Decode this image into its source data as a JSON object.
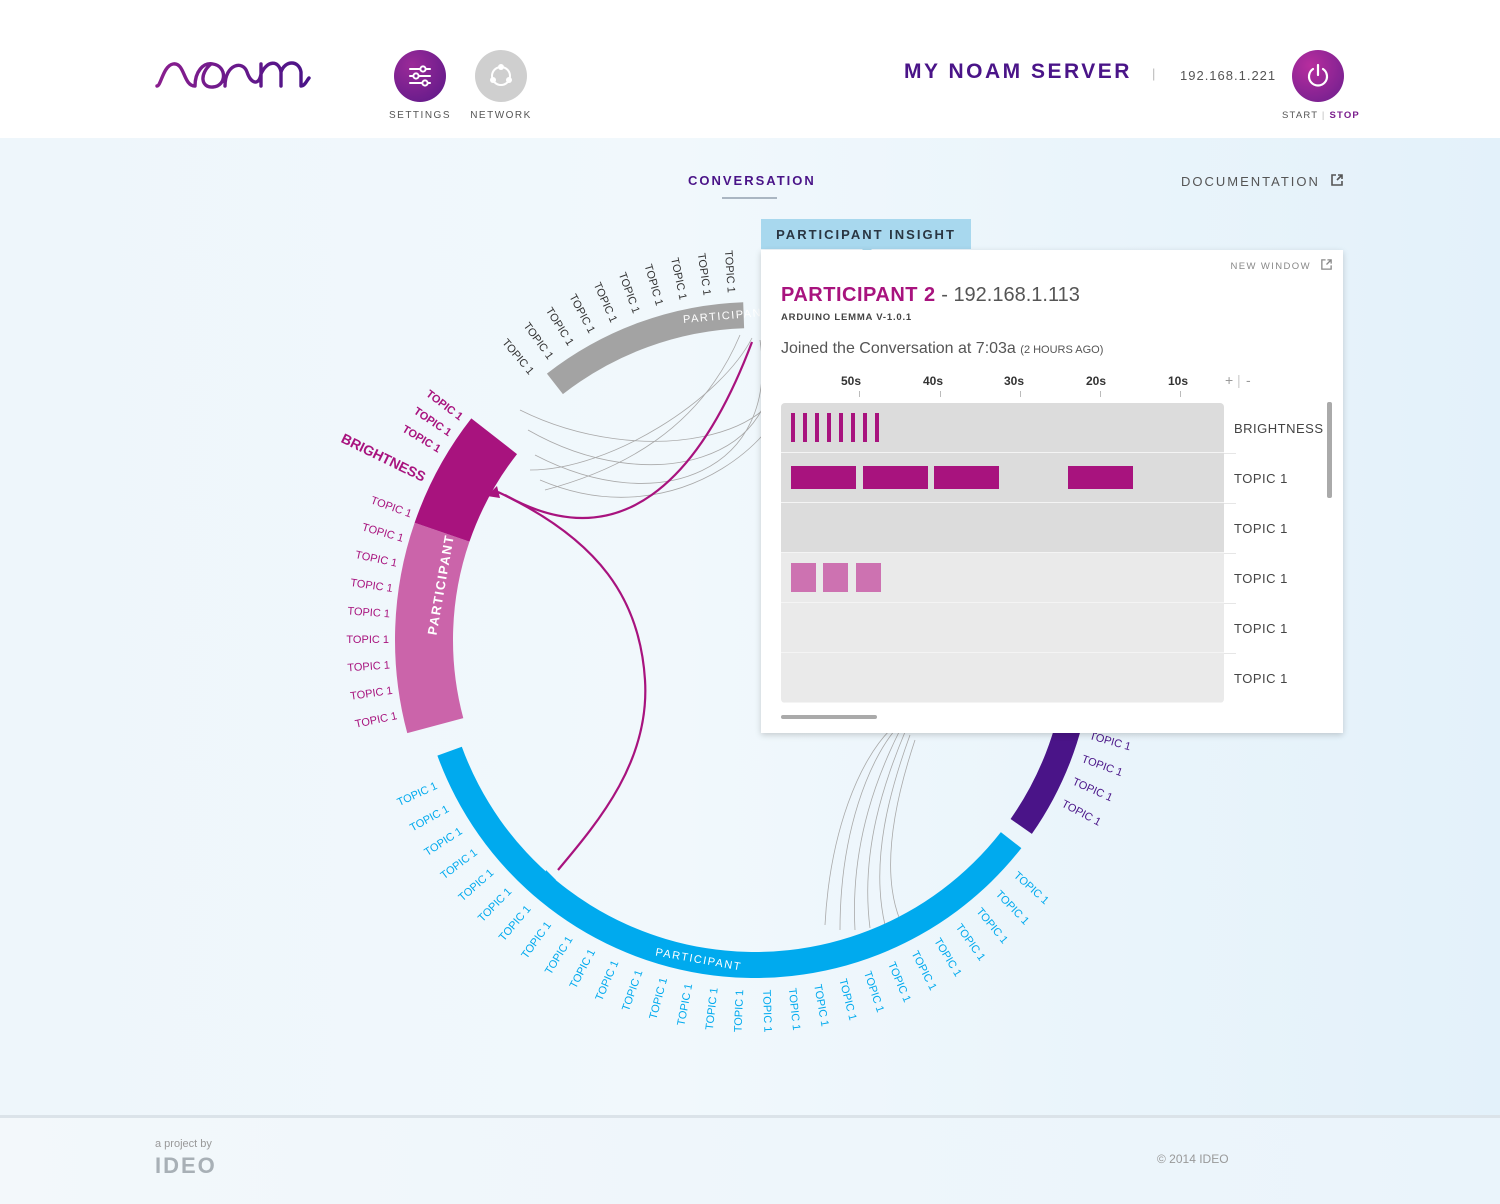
{
  "header": {
    "logo_text": "noam",
    "nav": [
      {
        "label": "SETTINGS",
        "icon": "sliders-icon"
      },
      {
        "label": "NETWORK",
        "icon": "network-icon"
      }
    ],
    "server_title": "MY NOAM SERVER",
    "separator": "|",
    "server_ip": "192.168.1.221",
    "power": {
      "start_label": "START",
      "stop_label": "STOP",
      "icon": "power-icon"
    }
  },
  "tabs": {
    "conversation": "CONVERSATION",
    "documentation": "DOCUMENTATION"
  },
  "colors": {
    "magenta": "#a8137e",
    "pink": "#cb64aa",
    "blue": "#00aaee",
    "purple": "#4a1488",
    "gray": "#a3a3a3"
  },
  "chord": {
    "participant_label": "PARTICIPANT",
    "brightness_label": "BRIGHTNESS",
    "topic_label": "TOPIC 1",
    "gray_arc_label": "PARTICIPANT"
  },
  "insight": {
    "tab_label": "PARTICIPANT INSIGHT",
    "new_window": "NEW WINDOW",
    "participant_name": "PARTICIPANT 2",
    "name_separator": " - ",
    "participant_ip": "192.168.1.113",
    "device": "ARDUINO LEMMA V-1.0.1",
    "joined_text": "Joined the Conversation at 7:03a",
    "joined_ago": "(2 HOURS AGO)",
    "time_axis": [
      "50s",
      "40s",
      "30s",
      "20s",
      "10s"
    ],
    "zoom_in": "+",
    "zoom_sep": "|",
    "zoom_out": "-",
    "rows": [
      {
        "label": "BRIGHTNESS",
        "bg": "#dcdcdc",
        "tone": "dark",
        "events": [
          [
            4,
            6
          ],
          [
            9,
            11
          ],
          [
            14,
            16
          ],
          [
            19,
            21
          ],
          [
            24,
            26
          ],
          [
            29,
            31
          ],
          [
            34,
            36
          ],
          [
            39,
            41
          ]
        ]
      },
      {
        "label": "TOPIC 1",
        "bg": "#dcdcdc",
        "tone": "dark",
        "events": [
          [
            4,
            65
          ],
          [
            55,
            116
          ],
          [
            121,
            182
          ],
          [
            179,
            240
          ]
        ]
      },
      {
        "label": "TOPIC 1",
        "bg": "#dcdcdc",
        "tone": "dark",
        "events": []
      },
      {
        "label": "TOPIC 1",
        "bg": "#eaeaea",
        "tone": "light",
        "events": [
          [
            4,
            28
          ],
          [
            6,
            28
          ],
          [
            8,
            28
          ]
        ]
      },
      {
        "label": "TOPIC 1",
        "bg": "#eaeaea",
        "tone": "light",
        "events": []
      },
      {
        "label": "TOPIC 1",
        "bg": "#eaeaea",
        "tone": "light",
        "events": []
      }
    ]
  },
  "footer": {
    "project_by": "a project by",
    "company": "IDEO",
    "copyright": "© 2014 IDEO"
  }
}
